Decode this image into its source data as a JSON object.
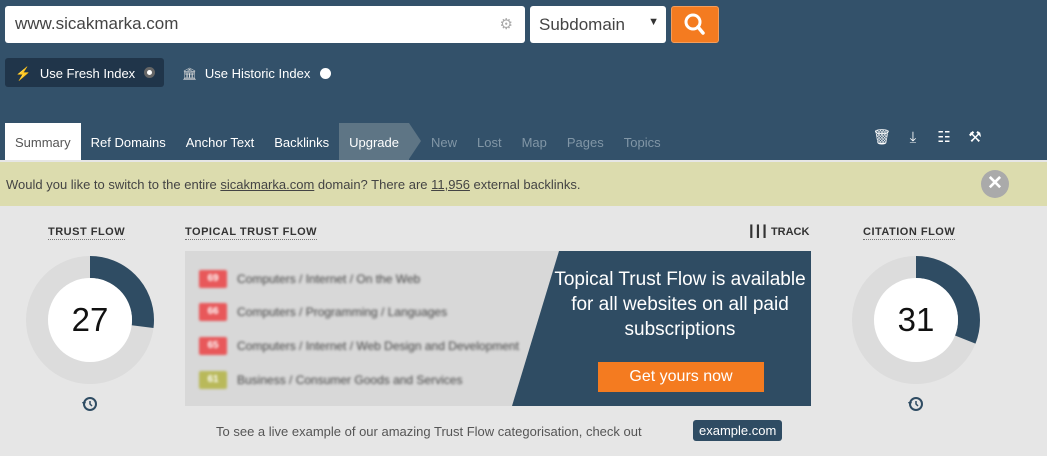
{
  "search": {
    "value": "www.sicakmarka.com",
    "gear_icon": "gear-icon"
  },
  "scope": {
    "selected": "Subdomain"
  },
  "go_button": {
    "icon": "search-icon",
    "color": "#f47b20"
  },
  "index": {
    "fresh_label": "Use Fresh Index",
    "historic_label": "Use Historic Index",
    "selected": "fresh"
  },
  "tabs": [
    {
      "label": "Summary",
      "state": "active"
    },
    {
      "label": "Ref Domains",
      "state": "normal"
    },
    {
      "label": "Anchor Text",
      "state": "normal"
    },
    {
      "label": "Backlinks",
      "state": "normal"
    },
    {
      "label": "Upgrade",
      "state": "upgrade"
    },
    {
      "label": "New",
      "state": "disabled"
    },
    {
      "label": "Lost",
      "state": "disabled"
    },
    {
      "label": "Map",
      "state": "disabled"
    },
    {
      "label": "Pages",
      "state": "disabled"
    },
    {
      "label": "Topics",
      "state": "disabled"
    }
  ],
  "tools": [
    "bin-add-icon",
    "download-icon",
    "report-add-icon",
    "tools-icon"
  ],
  "notice": {
    "text_before": "Would you like to switch to the entire ",
    "domain": "sicakmarka.com",
    "text_middle": " domain? There are ",
    "count": "11,956",
    "text_after": " external backlinks."
  },
  "trust_flow": {
    "title": "TRUST FLOW",
    "value": "27",
    "fraction": 0.27,
    "color": "#2f4c63"
  },
  "citation_flow": {
    "title": "CITATION FLOW",
    "value": "31",
    "fraction": 0.31,
    "color": "#2f4c63"
  },
  "topical": {
    "title": "TOPICAL TRUST FLOW",
    "track_label": "TRACK",
    "rows": [
      {
        "score": "69",
        "topic": "Computers / Internet / On the Web",
        "color": "#e8585a"
      },
      {
        "score": "66",
        "topic": "Computers / Programming / Languages",
        "color": "#e8585a"
      },
      {
        "score": "65",
        "topic": "Computers / Internet / Web Design and Development",
        "color": "#e8585a"
      },
      {
        "score": "61",
        "topic": "Business / Consumer Goods and Services",
        "color": "#b9b95a"
      }
    ],
    "promo_text": "Topical Trust Flow is available for all websites on all paid subscriptions",
    "promo_button": "Get yours now"
  },
  "example": {
    "text": "To see a live example of our amazing Trust Flow categorisation, check out",
    "link": "example.com"
  }
}
